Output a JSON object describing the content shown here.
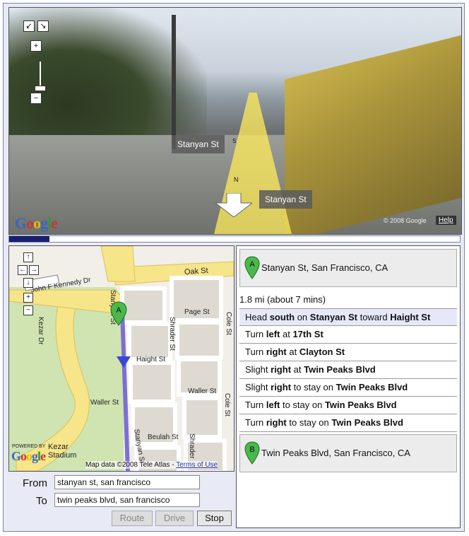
{
  "street_view": {
    "label_upper": "Stanyan St",
    "label_lower": "Stanyan St",
    "compass_letter": "N",
    "compass_south": "S",
    "copyright": "© 2008 Google",
    "help": "Help",
    "logo": "Google"
  },
  "progress": {
    "fraction": 0.09
  },
  "map": {
    "labels": {
      "oak_st": "Oak St",
      "page_st": "Page St",
      "haight_st": "Haight St",
      "waller_st": "Waller St",
      "waller_st_left": "Waller St",
      "beulah_st": "Beulah St",
      "kennedy_dr": "John F Kennedy Dr",
      "kezar_dr": "Kezar Dr",
      "shrader_st": "Shrader St",
      "shrader_st_lower": "Shrader",
      "cole_st": "Cole St",
      "cole_st_lower": "Cole St",
      "stanyan_st_upper": "Stanyan St",
      "stanyan_st_lower": "Stanyan St",
      "kezar_stadium": "Kezar Stadium",
      "powered_by": "POWERED BY",
      "logo": "Google"
    },
    "attribution": "Map data ©2008 Tele Atlas -",
    "terms": "Terms of Use"
  },
  "form": {
    "from_label": "From",
    "from_value": "stanyan st, san francisco",
    "to_label": "To",
    "to_value": "twin peaks blvd, san francisco",
    "route": "Route",
    "drive": "Drive",
    "stop": "Stop"
  },
  "directions": {
    "start": {
      "marker": "A",
      "address": "Stanyan St, San Francisco, CA"
    },
    "summary": "1.8 mi (about 7 mins)",
    "steps": [
      {
        "a": "Head ",
        "b": "south",
        "c": " on ",
        "d": "Stanyan St",
        "e": " toward ",
        "f": "Haight St"
      },
      {
        "a": "Turn ",
        "b": "left",
        "c": " at ",
        "d": "17th St",
        "e": "",
        "f": ""
      },
      {
        "a": "Turn ",
        "b": "right",
        "c": " at ",
        "d": "Clayton St",
        "e": "",
        "f": ""
      },
      {
        "a": "Slight ",
        "b": "right",
        "c": " at ",
        "d": "Twin Peaks Blvd",
        "e": "",
        "f": ""
      },
      {
        "a": "Slight ",
        "b": "right",
        "c": " to stay on ",
        "d": "Twin Peaks Blvd",
        "e": "",
        "f": ""
      },
      {
        "a": "Turn ",
        "b": "left",
        "c": " to stay on ",
        "d": "Twin Peaks Blvd",
        "e": "",
        "f": ""
      },
      {
        "a": "Turn ",
        "b": "right",
        "c": " to stay on ",
        "d": "Twin Peaks Blvd",
        "e": "",
        "f": ""
      }
    ],
    "end": {
      "marker": "B",
      "address": "Twin Peaks Blvd, San Francisco, CA"
    }
  }
}
